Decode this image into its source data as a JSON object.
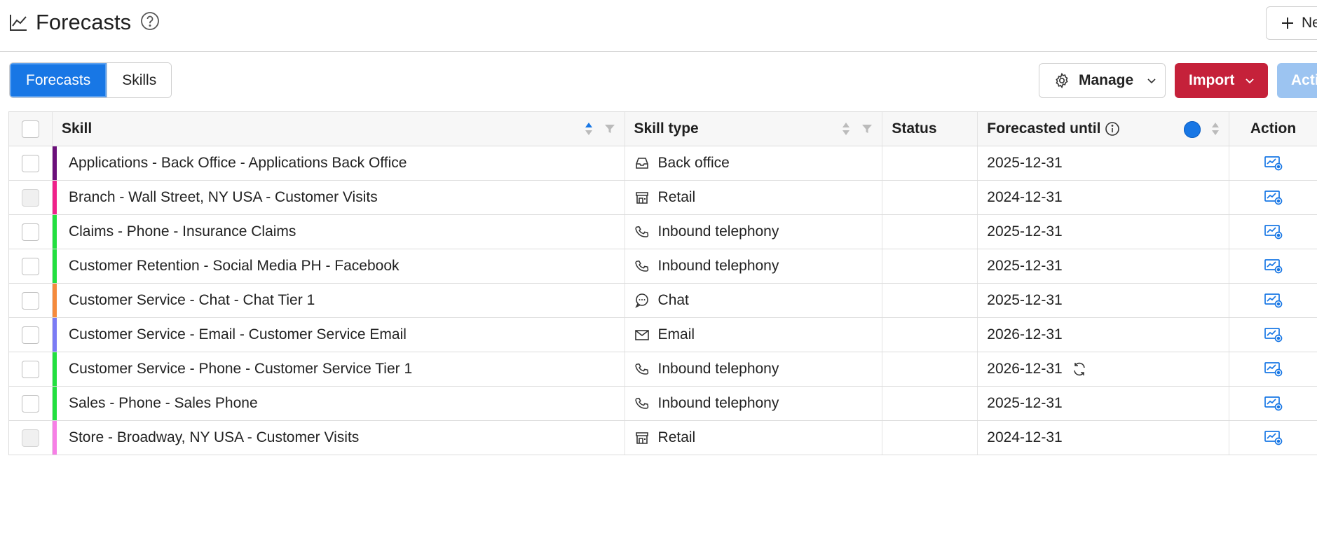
{
  "header": {
    "title": "Forecasts",
    "new_label": "Ne"
  },
  "tabs": [
    {
      "label": "Forecasts",
      "active": true
    },
    {
      "label": "Skills",
      "active": false
    }
  ],
  "toolbar": {
    "manage_label": "Manage",
    "import_label": "Import",
    "actions_label": "Acti"
  },
  "table": {
    "columns": {
      "skill": "Skill",
      "skill_type": "Skill type",
      "status": "Status",
      "forecasted_until": "Forecasted until",
      "action": "Action"
    },
    "rows": [
      {
        "skill": "Applications - Back Office - Applications Back Office",
        "color": "#6b0f7a",
        "type": "Back office",
        "type_icon": "inbox-icon",
        "status": "",
        "until": "2025-12-31",
        "syncing": false,
        "checkbox_disabled": false
      },
      {
        "skill": "Branch - Wall Street, NY USA - Customer Visits",
        "color": "#f0218a",
        "type": "Retail",
        "type_icon": "store-icon",
        "status": "",
        "until": "2024-12-31",
        "syncing": false,
        "checkbox_disabled": true
      },
      {
        "skill": "Claims - Phone - Insurance Claims",
        "color": "#22e03f",
        "type": "Inbound telephony",
        "type_icon": "phone-icon",
        "status": "",
        "until": "2025-12-31",
        "syncing": false,
        "checkbox_disabled": false
      },
      {
        "skill": "Customer Retention - Social Media PH - Facebook",
        "color": "#22e03f",
        "type": "Inbound telephony",
        "type_icon": "phone-icon",
        "status": "",
        "until": "2025-12-31",
        "syncing": false,
        "checkbox_disabled": false
      },
      {
        "skill": "Customer Service - Chat - Chat Tier 1",
        "color": "#f58a3c",
        "type": "Chat",
        "type_icon": "chat-icon",
        "status": "",
        "until": "2025-12-31",
        "syncing": false,
        "checkbox_disabled": false
      },
      {
        "skill": "Customer Service - Email - Customer Service Email",
        "color": "#7b7cf5",
        "type": "Email",
        "type_icon": "email-icon",
        "status": "",
        "until": "2026-12-31",
        "syncing": false,
        "checkbox_disabled": false
      },
      {
        "skill": "Customer Service - Phone - Customer Service Tier 1",
        "color": "#22e03f",
        "type": "Inbound telephony",
        "type_icon": "phone-icon",
        "status": "",
        "until": "2026-12-31",
        "syncing": true,
        "checkbox_disabled": false
      },
      {
        "skill": "Sales - Phone - Sales Phone",
        "color": "#22e03f",
        "type": "Inbound telephony",
        "type_icon": "phone-icon",
        "status": "",
        "until": "2025-12-31",
        "syncing": false,
        "checkbox_disabled": false
      },
      {
        "skill": "Store - Broadway, NY USA - Customer Visits",
        "color": "#f77fe6",
        "type": "Retail",
        "type_icon": "store-icon",
        "status": "",
        "until": "2024-12-31",
        "syncing": false,
        "checkbox_disabled": true
      }
    ]
  },
  "colors": {
    "primary": "#1877e5",
    "danger": "#c5213a",
    "disabled_primary": "#9cc4f1"
  }
}
